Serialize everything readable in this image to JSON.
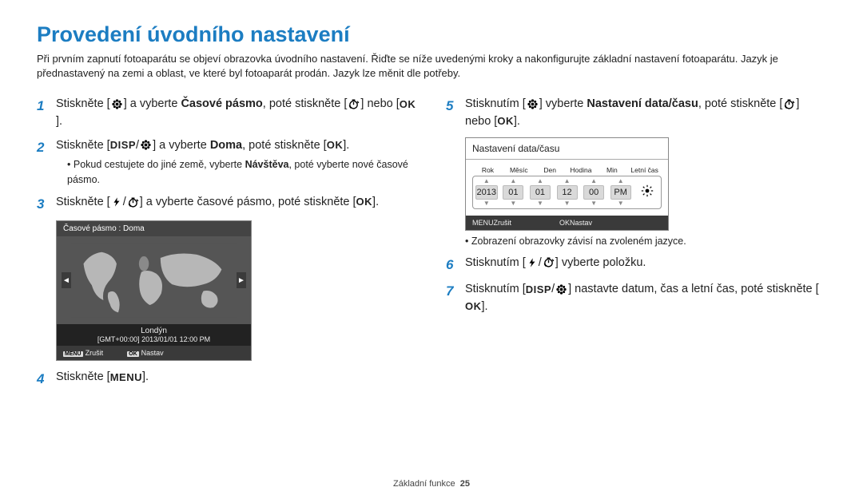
{
  "title": "Provedení úvodního nastavení",
  "intro": "Při prvním zapnutí fotoaparátu se objeví obrazovka úvodního nastavení. Řiďte se níže uvedenými kroky a nakonfigurujte základní nastavení fotoaparátu. Jazyk je přednastavený na zemi a oblast, ve které byl fotoaparát prodán. Jazyk lze měnit dle potřeby.",
  "steps": {
    "s1_a": "Stiskněte [",
    "s1_b": "] a vyberte ",
    "s1_bold": "Časové pásmo",
    "s1_c": ", poté stiskněte [",
    "s1_d": "] nebo [",
    "s1_e": "].",
    "s2_a": "Stiskněte [",
    "s2_b": "] a vyberte ",
    "s2_bold": "Doma",
    "s2_c": ", poté stiskněte [",
    "s2_d": "].",
    "s2_sub_a": "Pokud cestujete do jiné země, vyberte ",
    "s2_sub_bold": "Návštěva",
    "s2_sub_b": ", poté vyberte nové časové pásmo.",
    "s3_a": "Stiskněte [",
    "s3_b": "] a vyberte časové pásmo, poté stiskněte [",
    "s3_c": "].",
    "s4_a": "Stiskněte [",
    "s4_b": "].",
    "s5_a": "Stisknutím [",
    "s5_b": "] vyberte ",
    "s5_bold": "Nastavení data/času",
    "s5_c": ", poté stiskněte [",
    "s5_d": "] nebo [",
    "s5_e": "].",
    "s6_a": "Stisknutím [",
    "s6_b": "] vyberte položku.",
    "s7_a": "Stisknutím [",
    "s7_b": "] nastavte datum, čas a letní čas, poté stiskněte [",
    "s7_c": "]."
  },
  "map": {
    "title": "Časové pásmo : Doma",
    "city": "Londýn",
    "gmt": "[GMT+00:00] 2013/01/01 12:00 PM",
    "cancel": "Zrušit",
    "set": "Nastav",
    "menu_tag": "MENU",
    "ok_tag": "OK"
  },
  "date": {
    "title": "Nastavení data/času",
    "h_year": "Rok",
    "h_month": "Měsíc",
    "h_day": "Den",
    "h_hour": "Hodina",
    "h_min": "Min",
    "h_dst": "Letní čas",
    "v_year": "2013",
    "v_month": "01",
    "v_day": "01",
    "v_hour": "12",
    "v_min": "00",
    "v_ampm": "PM",
    "cancel": "Zrušit",
    "set": "Nastav",
    "menu_tag": "MENU",
    "ok_tag": "OK",
    "note": "Zobrazení obrazovky závisí na zvoleném jazyce."
  },
  "labels": {
    "disp": "DISP",
    "ok": "OK",
    "menu": "MENU",
    "slash": "/"
  },
  "footer": {
    "section": "Základní funkce",
    "page": "25"
  }
}
